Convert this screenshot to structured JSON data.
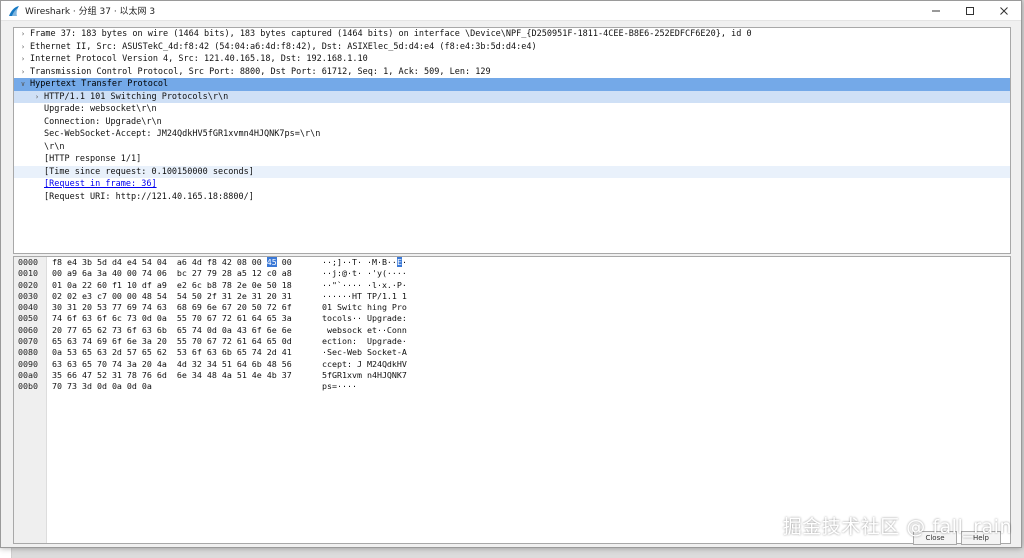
{
  "window": {
    "title": "Wireshark · 分组 37 · 以太网 3",
    "controls": [
      "minimize",
      "maximize",
      "close"
    ]
  },
  "tree": [
    {
      "text": "Frame 37: 183 bytes on wire (1464 bits), 183 bytes captured (1464 bits) on interface \\Device\\NPF_{D250951F-1811-4CEE-B8E6-252EDFCF6E20}, id 0",
      "arrow": "collapsed",
      "level": 0
    },
    {
      "text": "Ethernet II, Src: ASUSTekC_4d:f8:42 (54:04:a6:4d:f8:42), Dst: ASIXElec_5d:d4:e4 (f8:e4:3b:5d:d4:e4)",
      "arrow": "collapsed",
      "level": 0
    },
    {
      "text": "Internet Protocol Version 4, Src: 121.40.165.18, Dst: 192.168.1.10",
      "arrow": "collapsed",
      "level": 0
    },
    {
      "text": "Transmission Control Protocol, Src Port: 8800, Dst Port: 61712, Seq: 1, Ack: 509, Len: 129",
      "arrow": "collapsed",
      "level": 0
    },
    {
      "text": "Hypertext Transfer Protocol",
      "arrow": "expanded",
      "level": 0,
      "state": "sel"
    },
    {
      "text": "HTTP/1.1 101 Switching Protocols\\r\\n",
      "arrow": "collapsed",
      "level": 1,
      "state": "sel-child"
    },
    {
      "text": "Upgrade: websocket\\r\\n",
      "level": 1
    },
    {
      "text": "Connection: Upgrade\\r\\n",
      "level": 1
    },
    {
      "text": "Sec-WebSocket-Accept: JM24QdkHV5fGR1xvmn4HJQNK7ps=\\r\\n",
      "level": 1
    },
    {
      "text": "\\r\\n",
      "level": 1
    },
    {
      "text": "[HTTP response 1/1]",
      "level": 1
    },
    {
      "text": "[Time since request: 0.100150000 seconds]",
      "level": 1,
      "state": "alt"
    },
    {
      "text": "[Request in frame: 36]",
      "level": 1,
      "link": true
    },
    {
      "text": "[Request URI: http://121.40.165.18:8800/]",
      "level": 1
    }
  ],
  "hex": [
    {
      "off": "0000",
      "bytes": "f8 e4 3b 5d d4 e4 54 04  a6 4d f8 42 08 00 45 00",
      "ascii": "··;]··T· ·M·B··E·",
      "hl_byte": "45",
      "hl_ascii": "E"
    },
    {
      "off": "0010",
      "bytes": "00 a9 6a 3a 40 00 74 06  bc 27 79 28 a5 12 c0 a8",
      "ascii": "··j:@·t· ·'y(····"
    },
    {
      "off": "0020",
      "bytes": "01 0a 22 60 f1 10 df a9  e2 6c b8 78 2e 0e 50 18",
      "ascii": "··\"`···· ·l·x.·P·"
    },
    {
      "off": "0030",
      "bytes": "02 02 e3 c7 00 00 48 54  54 50 2f 31 2e 31 20 31",
      "ascii": "······HT TP/1.1 1"
    },
    {
      "off": "0040",
      "bytes": "30 31 20 53 77 69 74 63  68 69 6e 67 20 50 72 6f",
      "ascii": "01 Switc hing Pro"
    },
    {
      "off": "0050",
      "bytes": "74 6f 63 6f 6c 73 0d 0a  55 70 67 72 61 64 65 3a",
      "ascii": "tocols·· Upgrade:"
    },
    {
      "off": "0060",
      "bytes": "20 77 65 62 73 6f 63 6b  65 74 0d 0a 43 6f 6e 6e",
      "ascii": " websock et··Conn"
    },
    {
      "off": "0070",
      "bytes": "65 63 74 69 6f 6e 3a 20  55 70 67 72 61 64 65 0d",
      "ascii": "ection:  Upgrade·"
    },
    {
      "off": "0080",
      "bytes": "0a 53 65 63 2d 57 65 62  53 6f 63 6b 65 74 2d 41",
      "ascii": "·Sec-Web Socket-A"
    },
    {
      "off": "0090",
      "bytes": "63 63 65 70 74 3a 20 4a  4d 32 34 51 64 6b 48 56",
      "ascii": "ccept: J M24QdkHV"
    },
    {
      "off": "00a0",
      "bytes": "35 66 47 52 31 78 76 6d  6e 34 48 4a 51 4e 4b 37",
      "ascii": "5fGR1xvm n4HJQNK7"
    },
    {
      "off": "00b0",
      "bytes": "70 73 3d 0d 0a 0d 0a",
      "ascii": "ps=····"
    }
  ],
  "footer": {
    "close_label": "Close",
    "help_label": "Help"
  },
  "watermark": "掘金技术社区 @ fall_rain",
  "colors": {
    "selection": "#74a9e8",
    "selection_child": "#cfe0f6",
    "hex_highlight": "#3a78d6",
    "link": "#0000ee"
  }
}
